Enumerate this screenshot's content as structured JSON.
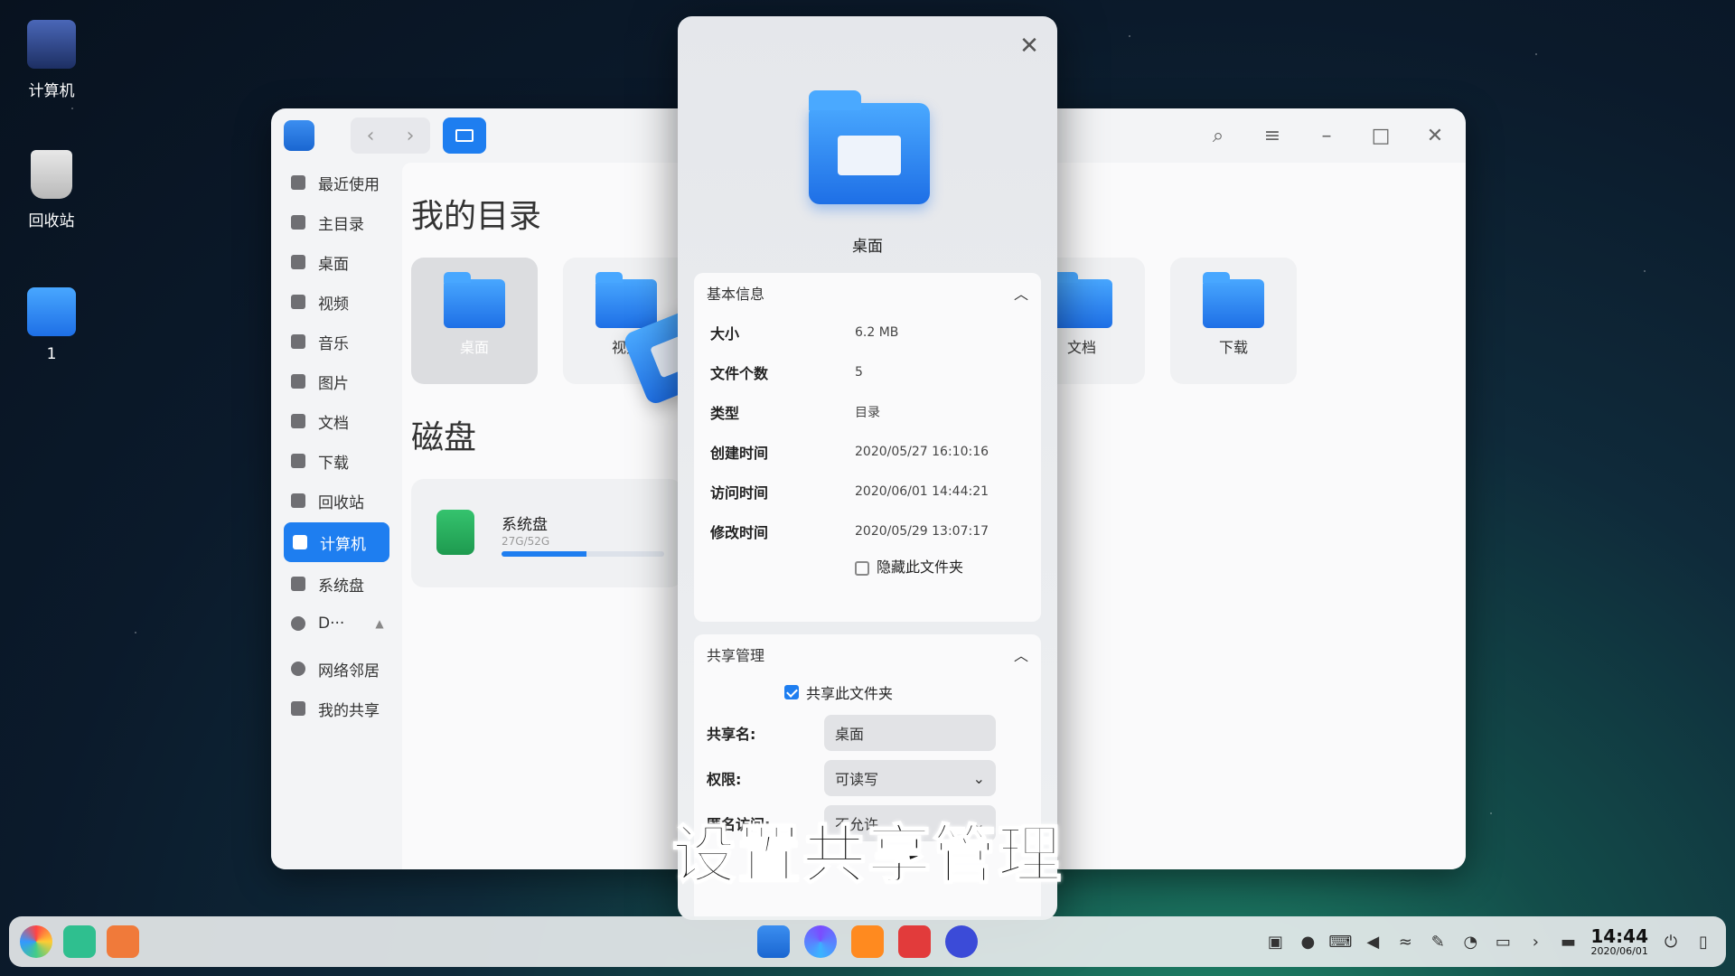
{
  "desktop": {
    "icons": [
      {
        "label": "计算机"
      },
      {
        "label": "回收站"
      },
      {
        "label": "1"
      }
    ]
  },
  "file_manager": {
    "sidebar": [
      {
        "label": "最近使用"
      },
      {
        "label": "主目录"
      },
      {
        "label": "桌面"
      },
      {
        "label": "视频"
      },
      {
        "label": "音乐"
      },
      {
        "label": "图片"
      },
      {
        "label": "文档"
      },
      {
        "label": "下载"
      },
      {
        "label": "回收站"
      },
      {
        "label": "计算机",
        "active": true
      },
      {
        "label": "系统盘"
      },
      {
        "label": "D···"
      },
      {
        "label": "网络邻居"
      },
      {
        "label": "我的共享"
      }
    ],
    "sections": {
      "my_dir": "我的目录",
      "disks": "磁盘"
    },
    "tiles": [
      {
        "label": "桌面"
      },
      {
        "label": "视频"
      },
      {
        "label": "文档"
      },
      {
        "label": "下载"
      }
    ],
    "disk": {
      "name": "系统盘",
      "size": "27G/52G",
      "usage": 0.52
    }
  },
  "properties_dialog": {
    "folder_name": "桌面",
    "basic_info": {
      "title": "基本信息",
      "rows": [
        {
          "key": "大小",
          "value": "6.2 MB"
        },
        {
          "key": "文件个数",
          "value": "5"
        },
        {
          "key": "类型",
          "value": "目录"
        },
        {
          "key": "创建时间",
          "value": "2020/05/27 16:10:16"
        },
        {
          "key": "访问时间",
          "value": "2020/06/01 14:44:21"
        },
        {
          "key": "修改时间",
          "value": "2020/05/29 13:07:17"
        }
      ],
      "hide_folder": "隐藏此文件夹"
    },
    "share": {
      "title": "共享管理",
      "share_folder": "共享此文件夹",
      "share_name_label": "共享名:",
      "share_name_value": "桌面",
      "permission_label": "权限:",
      "permission_value": "可读写",
      "anonymous_label": "匿名访问:",
      "anonymous_value": "不允许"
    }
  },
  "subtitle": "设置共享管理",
  "taskbar": {
    "time": "14:44",
    "date": "2020/06/01"
  }
}
